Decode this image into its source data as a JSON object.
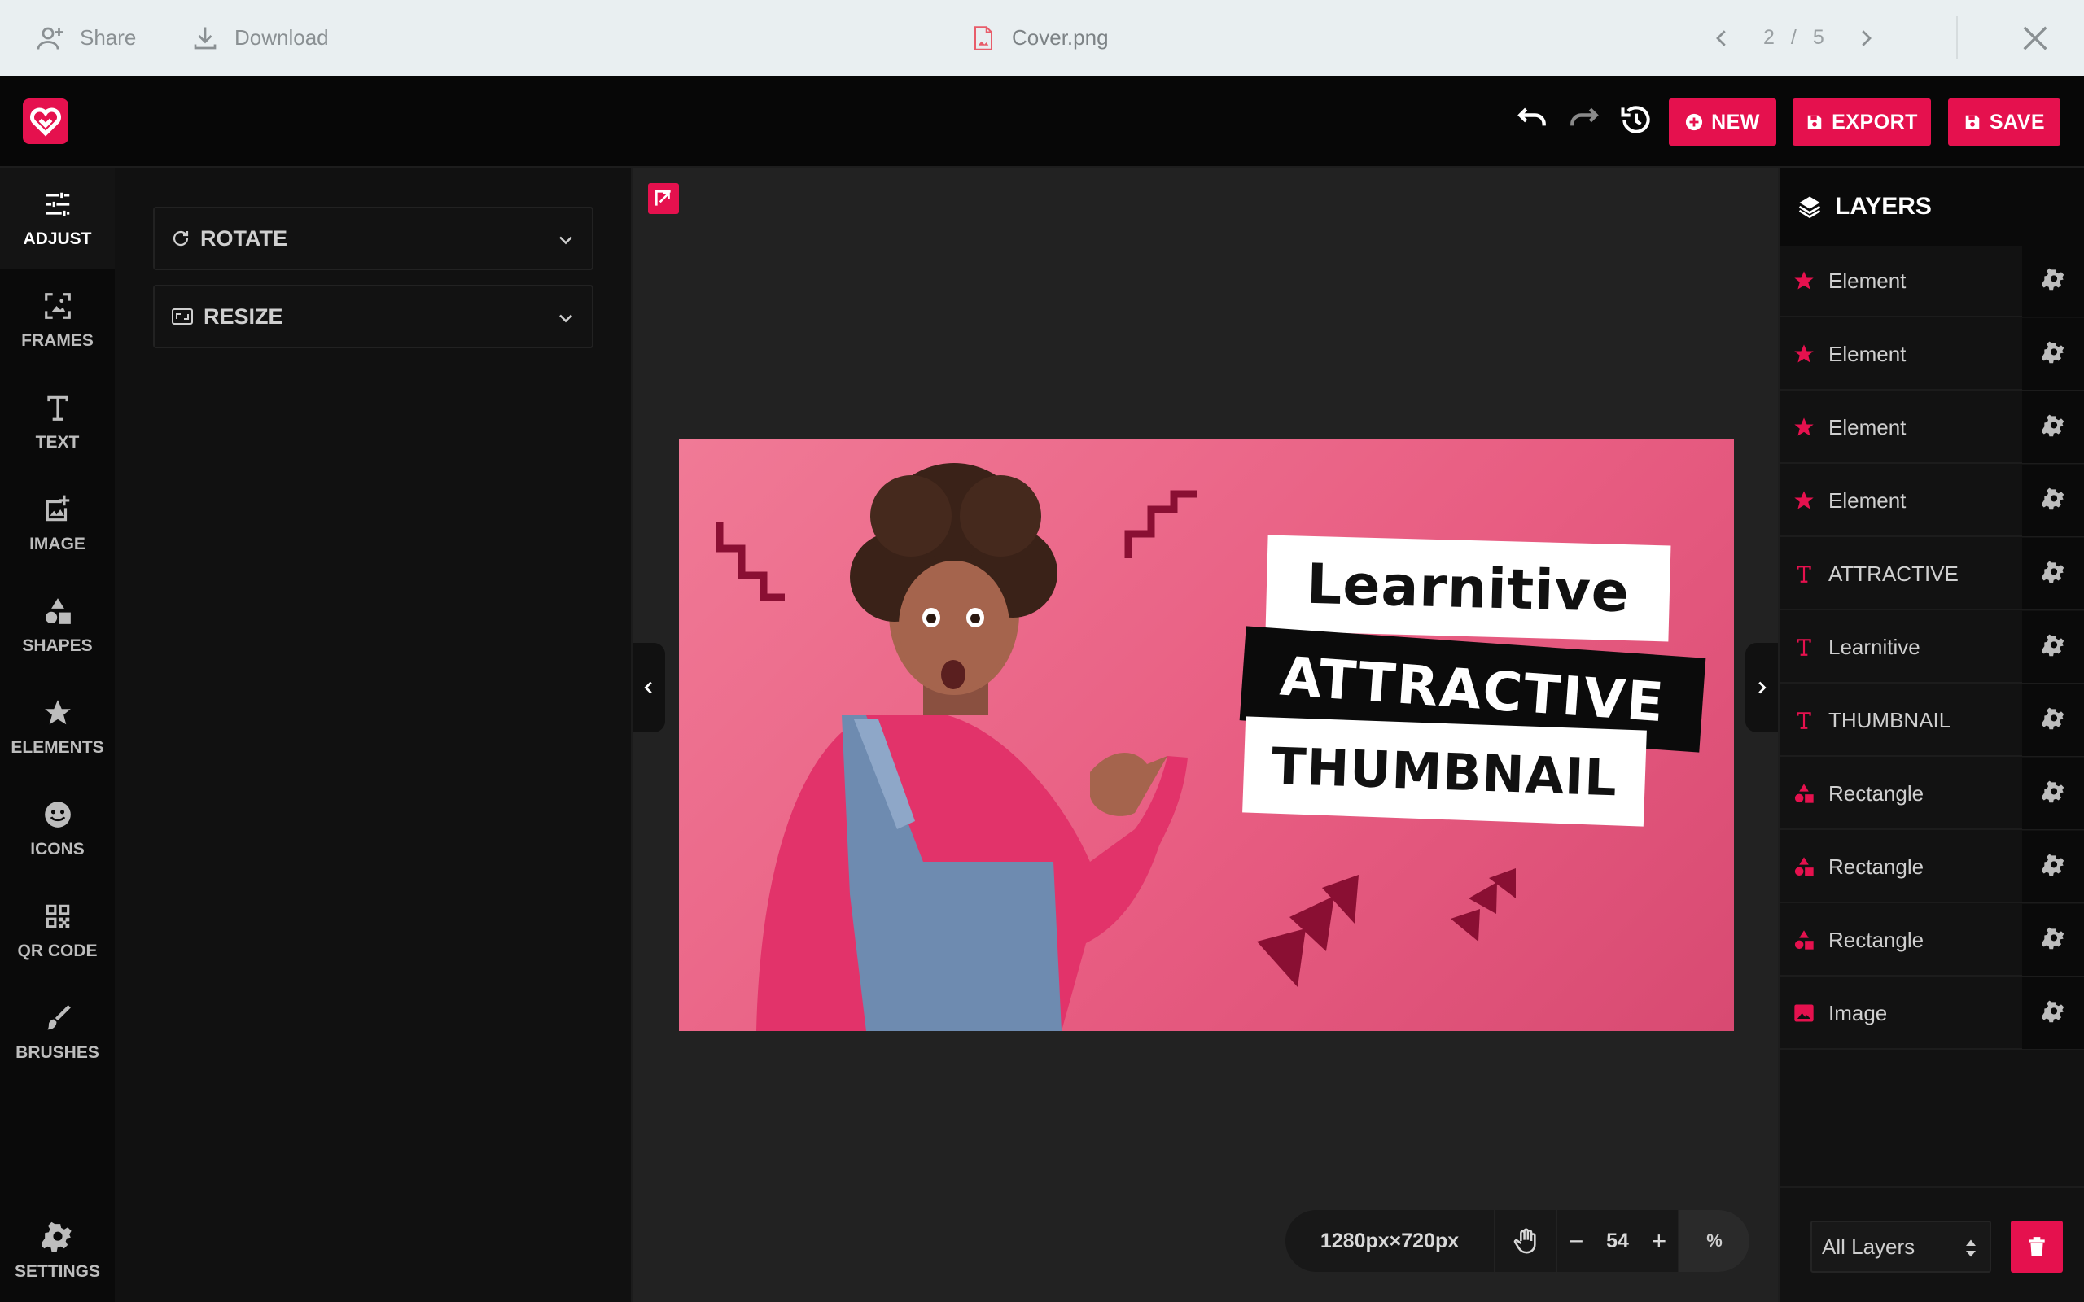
{
  "topbar": {
    "share_label": "Share",
    "download_label": "Download",
    "file_name": "Cover.png",
    "page_current": "2",
    "page_separator": "/",
    "page_total": "5"
  },
  "toolbar": {
    "new_label": "NEW",
    "export_label": "EXPORT",
    "save_label": "SAVE"
  },
  "sidebar": {
    "items": [
      {
        "label": "ADJUST",
        "icon": "sliders-icon",
        "active": true
      },
      {
        "label": "FRAMES",
        "icon": "frame-image-icon"
      },
      {
        "label": "TEXT",
        "icon": "text-t-icon"
      },
      {
        "label": "IMAGE",
        "icon": "add-image-icon"
      },
      {
        "label": "SHAPES",
        "icon": "shapes-icon"
      },
      {
        "label": "ELEMENTS",
        "icon": "star-icon"
      },
      {
        "label": "ICONS",
        "icon": "smiley-icon"
      },
      {
        "label": "QR CODE",
        "icon": "qr-code-icon"
      },
      {
        "label": "BRUSHES",
        "icon": "brush-icon"
      }
    ],
    "settings_label": "SETTINGS"
  },
  "adjust_panel": {
    "rotate_label": "ROTATE",
    "resize_label": "RESIZE"
  },
  "canvas": {
    "line1": "Learnitive",
    "line2": "ATTRACTIVE",
    "line3": "THUMBNAIL"
  },
  "zoom": {
    "dimensions": "1280px×720px",
    "value": "54",
    "unit": "%"
  },
  "layers": {
    "title": "LAYERS",
    "items": [
      {
        "type": "element",
        "label": "Element"
      },
      {
        "type": "element",
        "label": "Element"
      },
      {
        "type": "element",
        "label": "Element"
      },
      {
        "type": "element",
        "label": "Element"
      },
      {
        "type": "text",
        "label": "ATTRACTIVE"
      },
      {
        "type": "text",
        "label": "Learnitive"
      },
      {
        "type": "text",
        "label": "THUMBNAIL"
      },
      {
        "type": "shape",
        "label": "Rectangle"
      },
      {
        "type": "shape",
        "label": "Rectangle"
      },
      {
        "type": "shape",
        "label": "Rectangle"
      },
      {
        "type": "image",
        "label": "Image"
      }
    ],
    "filter_value": "All Layers"
  },
  "colors": {
    "accent": "#e5114e",
    "canvas_pink": "#e85d82",
    "dark_shape": "#8a0f33"
  }
}
